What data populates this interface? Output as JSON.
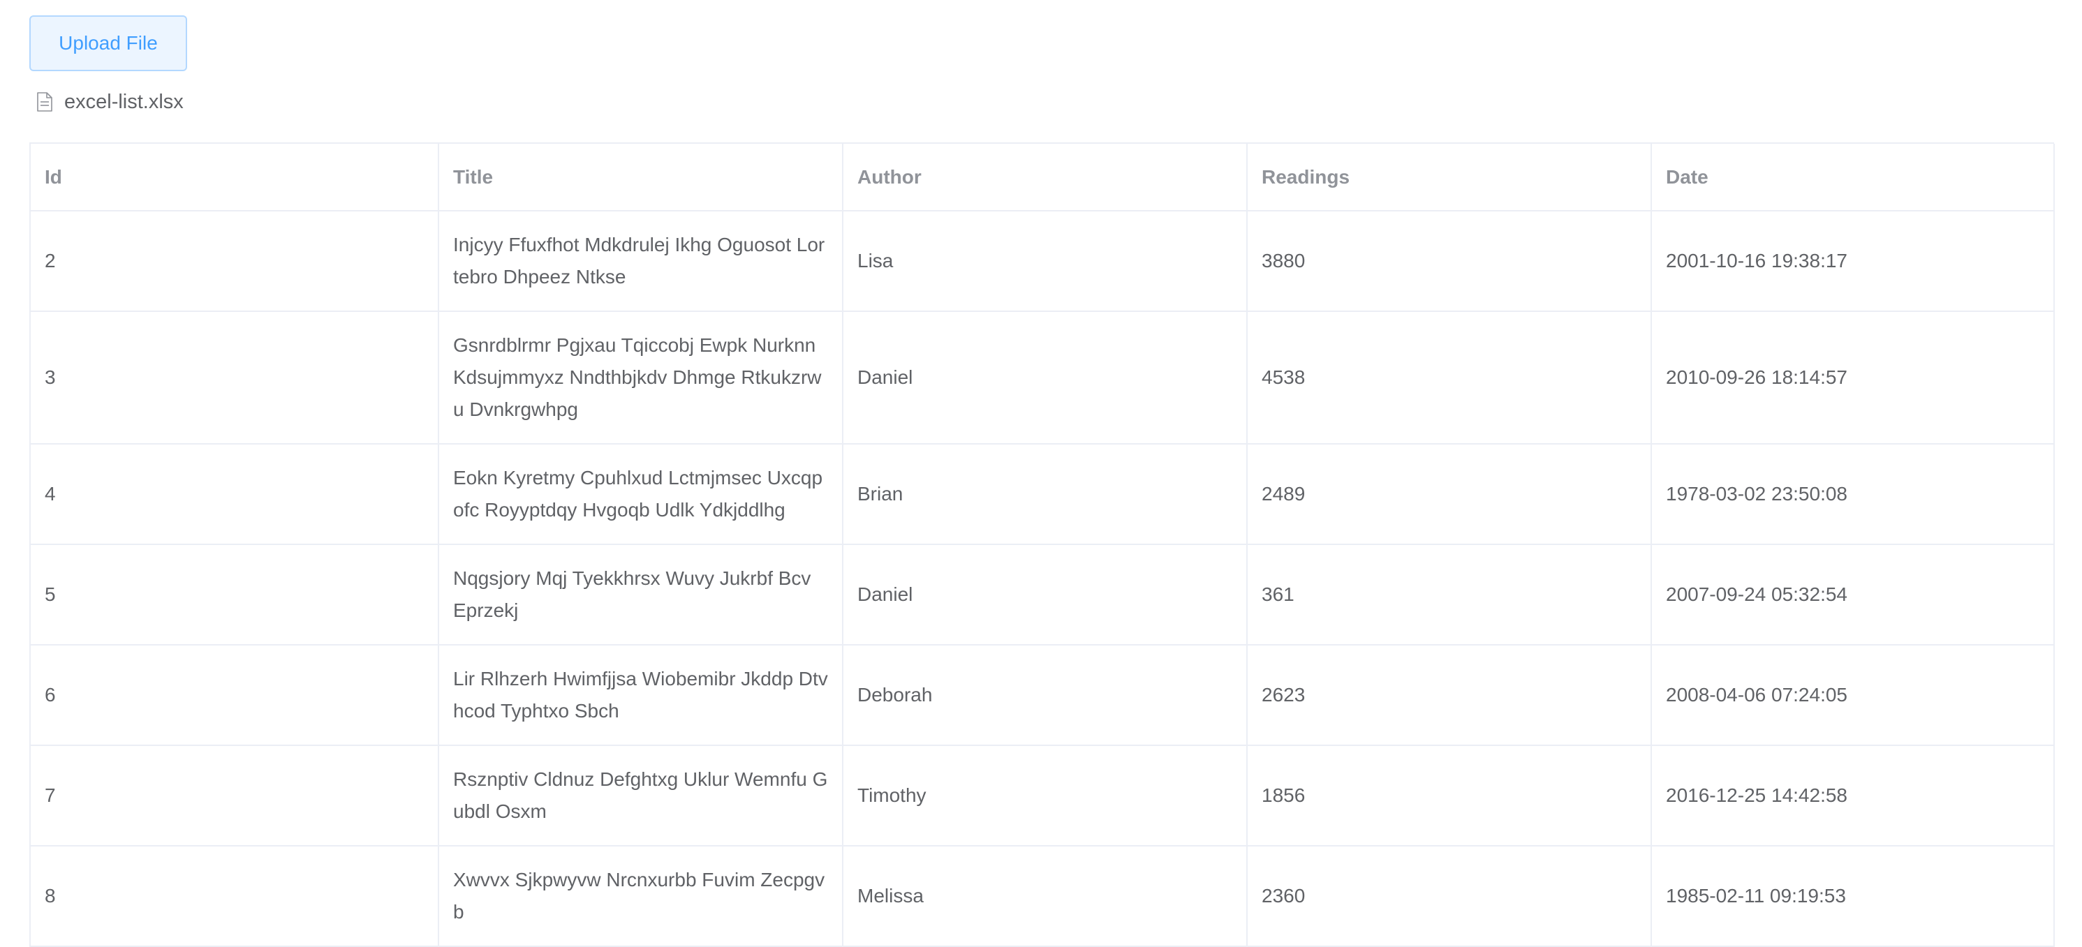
{
  "upload": {
    "label": "Upload File"
  },
  "file": {
    "name": "excel-list.xlsx",
    "icon": "document-icon"
  },
  "table": {
    "headers": {
      "id": "Id",
      "title": "Title",
      "author": "Author",
      "readings": "Readings",
      "date": "Date"
    },
    "rows": [
      {
        "id": "2",
        "title": "Injcyy Ffuxfhot Mdkdrulej Ikhg Oguosot Lortebro Dhpeez Ntkse",
        "author": "Lisa",
        "readings": "3880",
        "date": "2001-10-16 19:38:17"
      },
      {
        "id": "3",
        "title": "Gsnrdblrmr Pgjxau Tqiccobj Ewpk Nurknn Kdsujmmyxz Nndthbjkdv Dhmge Rtkukzrwu Dvnkrgwhpg",
        "author": "Daniel",
        "readings": "4538",
        "date": "2010-09-26 18:14:57"
      },
      {
        "id": "4",
        "title": "Eokn Kyretmy Cpuhlxud Lctmjmsec Uxcqpofc Royyptdqy Hvgoqb Udlk Ydkjddlhg",
        "author": "Brian",
        "readings": "2489",
        "date": "1978-03-02 23:50:08"
      },
      {
        "id": "5",
        "title": "Nqgsjory Mqj Tyekkhrsx Wuvy Jukrbf Bcv Eprzekj",
        "author": "Daniel",
        "readings": "361",
        "date": "2007-09-24 05:32:54"
      },
      {
        "id": "6",
        "title": "Lir Rlhzerh Hwimfjjsa Wiobemibr Jkddp Dtvhcod Typhtxo Sbch",
        "author": "Deborah",
        "readings": "2623",
        "date": "2008-04-06 07:24:05"
      },
      {
        "id": "7",
        "title": "Rsznptiv Cldnuz Defghtxg Uklur Wemnfu Gubdl Osxm",
        "author": "Timothy",
        "readings": "1856",
        "date": "2016-12-25 14:42:58"
      },
      {
        "id": "8",
        "title": "Xwvvx Sjkpwyvw Nrcnxurbb Fuvim Zecpgvb",
        "author": "Melissa",
        "readings": "2360",
        "date": "1985-02-11 09:19:53"
      }
    ]
  }
}
